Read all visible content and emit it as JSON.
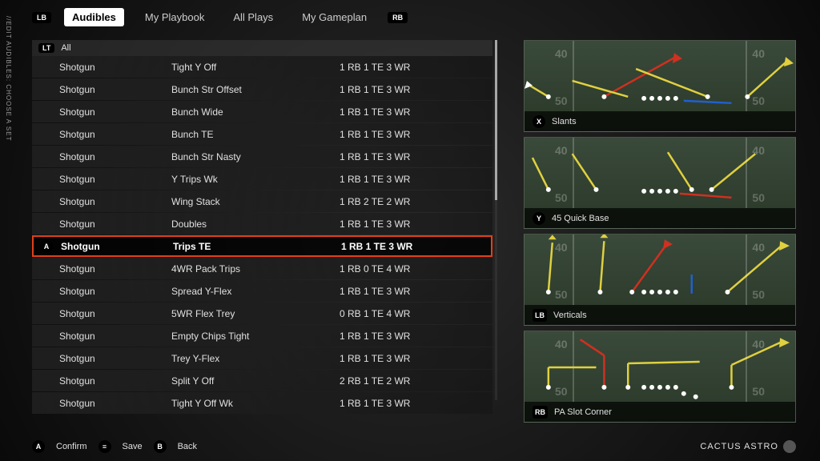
{
  "sidebar_label": "//EDIT AUDIBLES: CHOOSE A SET",
  "nav": {
    "lb": "LB",
    "rb": "RB",
    "tabs": [
      "Audibles",
      "My Playbook",
      "All Plays",
      "My Gameplan"
    ],
    "active_index": 0
  },
  "filter": {
    "lt": "LT",
    "label": "All"
  },
  "plays": [
    {
      "formation": "Shotgun",
      "name": "Tight Y Off",
      "personnel": "1 RB 1 TE 3 WR"
    },
    {
      "formation": "Shotgun",
      "name": "Bunch Str Offset",
      "personnel": "1 RB 1 TE 3 WR"
    },
    {
      "formation": "Shotgun",
      "name": "Bunch Wide",
      "personnel": "1 RB 1 TE 3 WR"
    },
    {
      "formation": "Shotgun",
      "name": "Bunch TE",
      "personnel": "1 RB 1 TE 3 WR"
    },
    {
      "formation": "Shotgun",
      "name": "Bunch Str Nasty",
      "personnel": "1 RB 1 TE 3 WR"
    },
    {
      "formation": "Shotgun",
      "name": "Y Trips Wk",
      "personnel": "1 RB 1 TE 3 WR"
    },
    {
      "formation": "Shotgun",
      "name": "Wing Stack",
      "personnel": "1 RB 2 TE 2 WR"
    },
    {
      "formation": "Shotgun",
      "name": "Doubles",
      "personnel": "1 RB 1 TE 3 WR"
    },
    {
      "formation": "Shotgun",
      "name": "Trips TE",
      "personnel": "1 RB 1 TE 3 WR",
      "selected": true,
      "btn": "A"
    },
    {
      "formation": "Shotgun",
      "name": "4WR Pack Trips",
      "personnel": "1 RB 0 TE 4 WR"
    },
    {
      "formation": "Shotgun",
      "name": "Spread Y-Flex",
      "personnel": "1 RB 1 TE 3 WR"
    },
    {
      "formation": "Shotgun",
      "name": "5WR Flex Trey",
      "personnel": "0 RB 1 TE 4 WR"
    },
    {
      "formation": "Shotgun",
      "name": "Empty Chips Tight",
      "personnel": "1 RB 1 TE 3 WR"
    },
    {
      "formation": "Shotgun",
      "name": "Trey Y-Flex",
      "personnel": "1 RB 1 TE 3 WR"
    },
    {
      "formation": "Shotgun",
      "name": "Split Y Off",
      "personnel": "2 RB 1 TE 2 WR"
    },
    {
      "formation": "Shotgun",
      "name": "Tight Y Off Wk",
      "personnel": "1 RB 1 TE 3 WR"
    }
  ],
  "cards": [
    {
      "btn": "X",
      "name": "Slants",
      "btn_shape": "round"
    },
    {
      "btn": "Y",
      "name": "45 Quick Base",
      "btn_shape": "round"
    },
    {
      "btn": "LB",
      "name": "Verticals",
      "btn_shape": "sq"
    },
    {
      "btn": "RB",
      "name": "PA Slot Corner",
      "btn_shape": "sq"
    }
  ],
  "yardmarks": {
    "left": "50",
    "right": "50",
    "left2": "40",
    "right2": "40"
  },
  "footer": {
    "confirm_btn": "A",
    "confirm": "Confirm",
    "save_btn": "≡",
    "save": "Save",
    "back_btn": "B",
    "back": "Back"
  },
  "gamertag": "CACTUS ASTRO"
}
